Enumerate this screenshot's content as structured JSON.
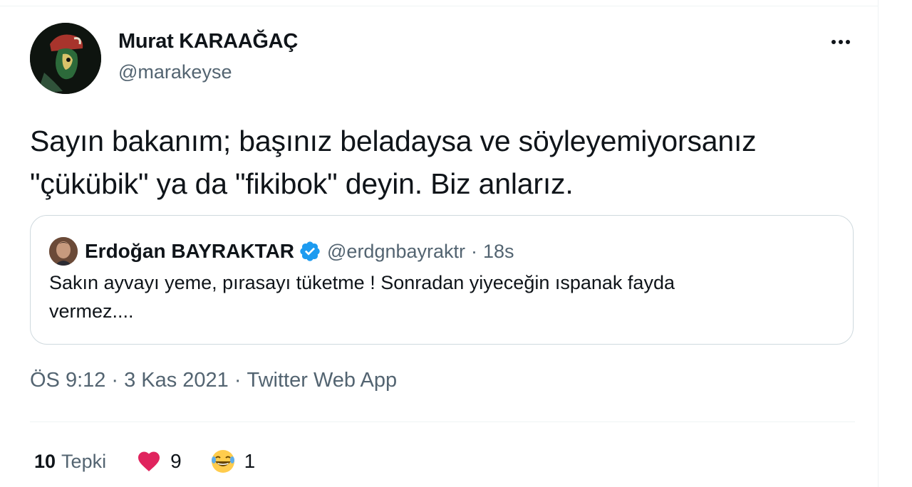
{
  "author": {
    "name": "Murat KARAAĞAÇ",
    "handle": "@marakeyse"
  },
  "tweet": {
    "text_line1": "Sayın bakanım; başınız beladaysa ve söyleyemiyorsanız",
    "text_line2": "\"çükübik\" ya da \"fikibok\" deyin. Biz anlarız."
  },
  "quoted": {
    "name": "Erdoğan BAYRAKTAR",
    "handle": "@erdgnbayraktr",
    "separator": "·",
    "time": "18s",
    "text_line1": "Sakın ayvayı yeme, pırasayı tüketme ! Sonradan yiyeceğin ıspanak fayda",
    "text_line2": "vermez...."
  },
  "meta": {
    "time": "ÖS 9:12",
    "separator": "·",
    "date": "3 Kas 2021",
    "source": "Twitter Web App"
  },
  "reactions": {
    "total": "10",
    "label": "Tepki",
    "heart_count": "9",
    "laugh_count": "1"
  },
  "colors": {
    "text_primary": "#0f1419",
    "text_secondary": "#536471",
    "border": "#cfd9de",
    "verified_blue": "#1d9bf0",
    "heart_red": "#f91880"
  },
  "icons": [
    "more-icon",
    "verified-badge-icon",
    "heart-icon",
    "laughing-emoji-icon"
  ]
}
